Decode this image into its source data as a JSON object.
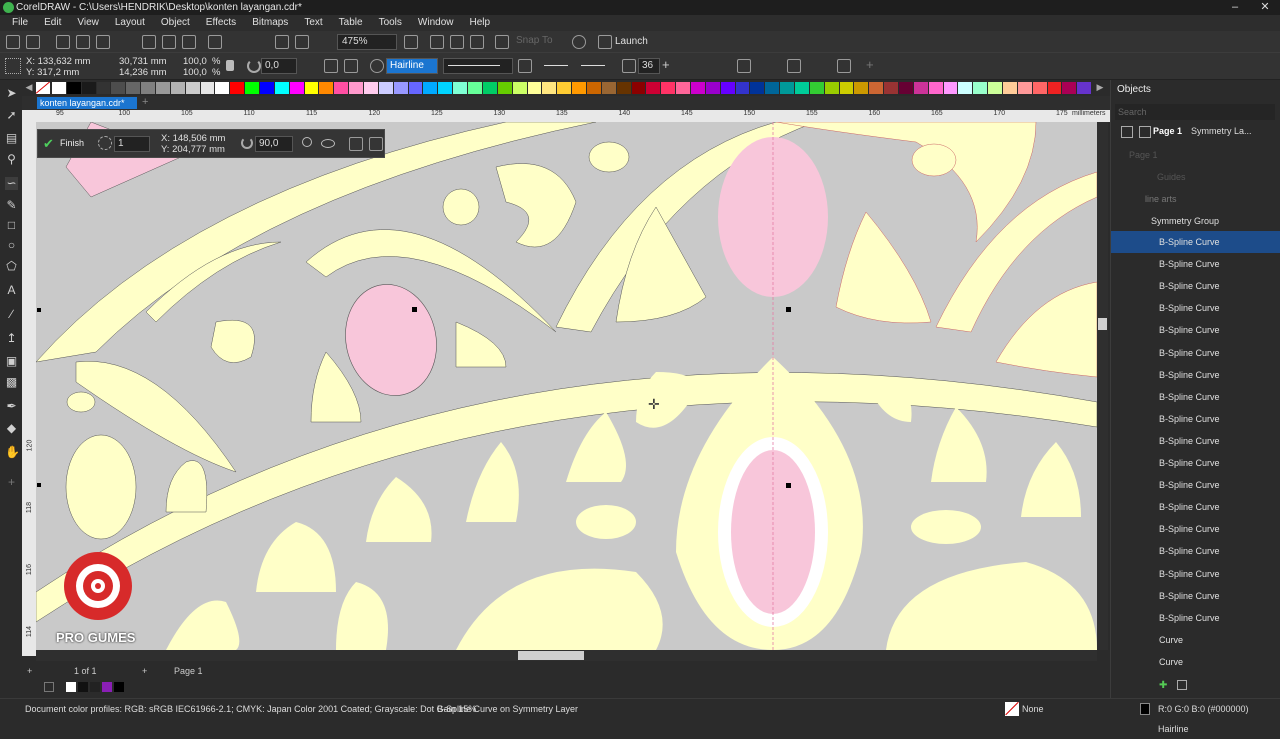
{
  "window": {
    "title": "CorelDRAW - C:\\Users\\HENDRIK\\Desktop\\konten layangan.cdr*"
  },
  "menu": [
    "File",
    "Edit",
    "View",
    "Layout",
    "Object",
    "Effects",
    "Bitmaps",
    "Text",
    "Table",
    "Tools",
    "Window",
    "Help"
  ],
  "toolbar": {
    "zoom": "475%",
    "snap_label": "Snap To",
    "launch_label": "Launch"
  },
  "props": {
    "x": "X: 133,632 mm",
    "y": "Y: 317,2 mm",
    "w": "30,731 mm",
    "h": "14,236 mm",
    "sx": "100,0",
    "sy": "100,0",
    "pct": "%",
    "angle": "0,0",
    "outline": "Hairline",
    "nodes": "36"
  },
  "doc_tab": "konten layangan.cdr*",
  "ruler": {
    "top_ticks": [
      "95",
      "100",
      "105",
      "110",
      "115",
      "120",
      "125",
      "130",
      "135",
      "140",
      "145",
      "150",
      "155",
      "160",
      "165",
      "170",
      "175"
    ],
    "unit": "millimeters",
    "left_ticks": [
      "120",
      "118",
      "116",
      "114"
    ]
  },
  "edit_bar": {
    "finish": "Finish",
    "count": "1",
    "x": "X: 148,506 mm",
    "y": "Y: 204,777 mm",
    "angle": "90,0"
  },
  "page_nav": {
    "count": "1 of 1",
    "page": "Page 1"
  },
  "status": {
    "profiles": "Document color profiles: RGB: sRGB IEC61966-2.1; CMYK: Japan Color 2001 Coated; Grayscale: Dot Gain 15%",
    "selection": "B-Spline Curve on Symmetry Layer",
    "fill": "None",
    "outline": "R:0 G:0 B:0 (#000000)  Hairline"
  },
  "objects": {
    "title": "Objects",
    "search": "Search",
    "page": "Page 1",
    "page_layer": "Symmetry La...",
    "page1_sub": "Page 1",
    "guides": "Guides",
    "layer": "line arts",
    "group": "Symmetry Group",
    "items": [
      "B-Spline Curve",
      "B-Spline Curve",
      "B-Spline Curve",
      "B-Spline Curve",
      "B-Spline Curve",
      "B-Spline Curve",
      "B-Spline Curve",
      "B-Spline Curve",
      "B-Spline Curve",
      "B-Spline Curve",
      "B-Spline Curve",
      "B-Spline Curve",
      "B-Spline Curve",
      "B-Spline Curve",
      "B-Spline Curve",
      "B-Spline Curve",
      "B-Spline Curve",
      "B-Spline Curve",
      "Curve",
      "Curve"
    ]
  },
  "watermark": {
    "text": "PRO GUMES"
  },
  "colors": {
    "cream": "#ffffc8",
    "pink": "#f8c6da",
    "canvas": "#c9c9c9",
    "accent": "#1b75d0"
  }
}
